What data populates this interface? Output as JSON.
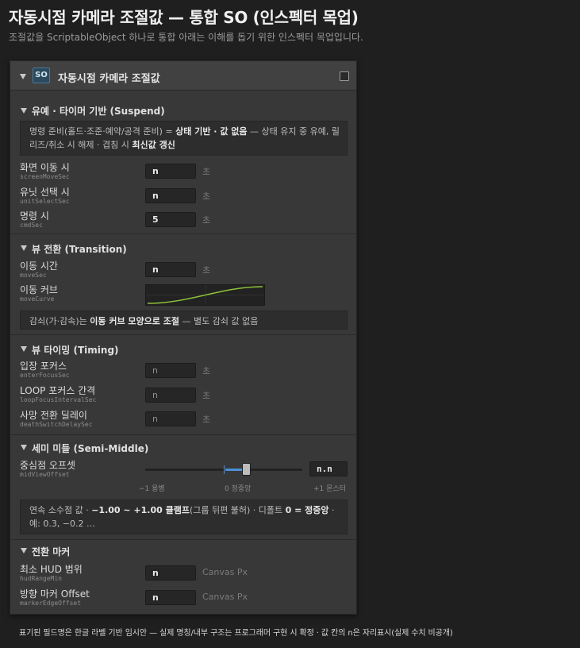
{
  "page": {
    "title": "자동시점 카메라 조절값 — 통합 SO (인스펙터 목업)",
    "subtitle": "조절값을 ScriptableObject 하나로 통합 아래는 이해를 돕기 위한 인스펙터 목업입니다."
  },
  "inspector": {
    "badge": "SO",
    "title": "자동시점 카메라 조절값"
  },
  "suspend": {
    "title": "유예 · 타이머 기반 (Suspend)",
    "info": {
      "p1": "명령 준비(홀드·조준·예약/공격 준비) = ",
      "b1": "상태 기반 · 값 없음",
      "p2": " — 상태 유지 중 유예, 릴리즈/취소 시 해제 · 겹침 시 ",
      "b2": "최신값 갱신"
    },
    "rows": [
      {
        "label": "화면 이동 시",
        "field": "screenMoveSec",
        "value": "n",
        "unit": "초"
      },
      {
        "label": "유닛 선택 시",
        "field": "unitSelectSec",
        "value": "n",
        "unit": "초"
      },
      {
        "label": "명령 시",
        "field": "cmdSec",
        "value": "5",
        "unit": "초"
      }
    ]
  },
  "transition": {
    "title": "뷰 전환 (Transition)",
    "rows": [
      {
        "label": "이동 시간",
        "field": "moveSec",
        "value": "n",
        "unit": "초"
      },
      {
        "label": "이동 커브",
        "field": "moveCurve"
      }
    ],
    "info": {
      "p1": "감쇠(가·감속)는 ",
      "b1": "이동 커브 모양으로 조절",
      "p2": " — 별도 감쇠 값 없음"
    }
  },
  "timing": {
    "title": "뷰 타이밍 (Timing)",
    "rows": [
      {
        "label": "입장 포커스",
        "field": "enterFocusSec",
        "value": "n",
        "unit": "초"
      },
      {
        "label": "LOOP 포커스 간격",
        "field": "loopFocusIntervalSec",
        "value": "n",
        "unit": "초"
      },
      {
        "label": "사망 전환 딜레이",
        "field": "deathSwitchDelaySec",
        "value": "n",
        "unit": "초"
      }
    ]
  },
  "semi": {
    "title": "세미 미들 (Semi-Middle)",
    "row": {
      "label": "중심점 오프셋",
      "field": "midViewOffset",
      "value": "n.n"
    },
    "slider": {
      "position": 0.6,
      "tick_min": "−1 용병",
      "tick_mid": "0 정중앙",
      "tick_max": "+1 몬스터"
    },
    "info": {
      "p1": "연속 소수점 값 · ",
      "b1": "−1.00 ~ +1.00 클램프",
      "p2": "(그룹 뒤편 불허) · 디폴트 ",
      "b2": "0 = 정중앙",
      "p3": " · 예: 0.3, −0.2 …"
    }
  },
  "marker": {
    "title": "전환 마커",
    "rows": [
      {
        "label": "최소 HUD 범위",
        "field": "hudRangeMin",
        "value": "n",
        "unit": "Canvas Px"
      },
      {
        "label": "방향 마커 Offset",
        "field": "markerEdgeOffset",
        "value": "n",
        "unit": "Canvas Px"
      }
    ]
  },
  "footnote": "표기된 필드명은 한글 라벨 기반 임시안 — 실제 명칭/내부 구조는 프로그래머 구현 시 확정 · 값 칸의 n은 자리표시(실제 수치 비공개)",
  "icons": {
    "foldout": "triangle-down-icon",
    "checkbox": "checkbox-icon"
  },
  "colors": {
    "background": "#1f1f1f",
    "panel": "#383838",
    "curve": "#8fc43a",
    "slider_fill": "#4a90d9",
    "badge": "#2c4a5e"
  }
}
